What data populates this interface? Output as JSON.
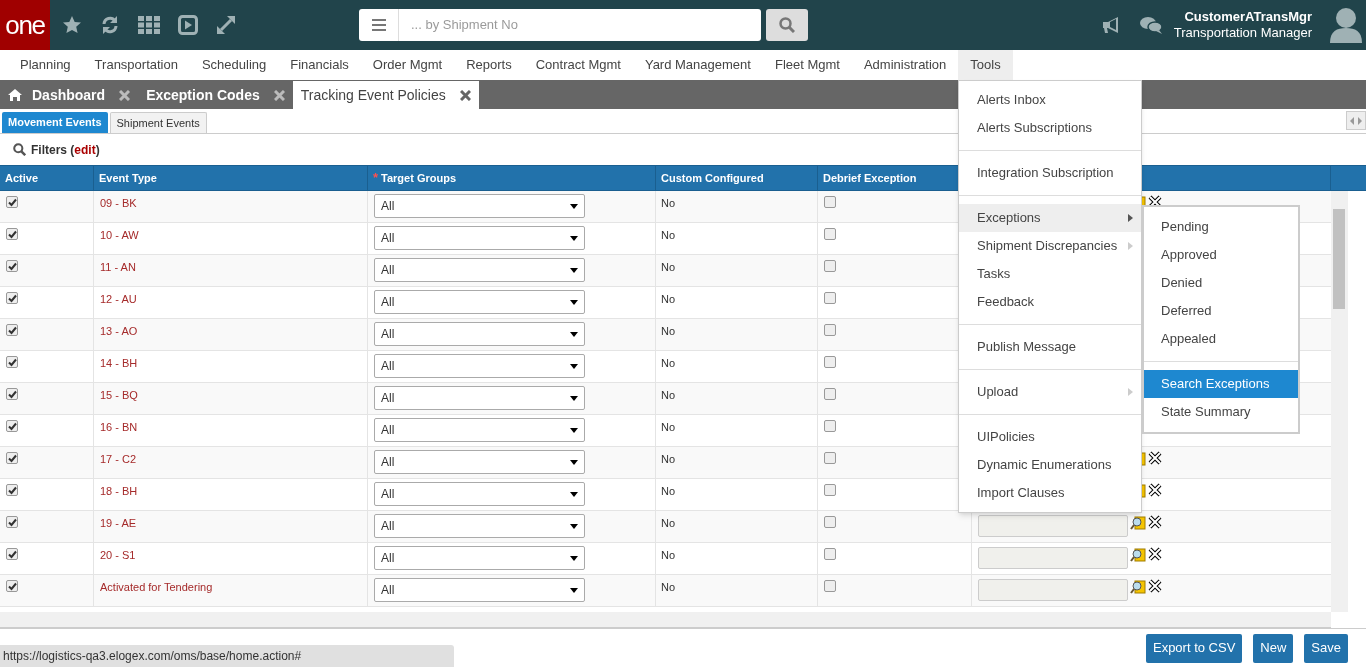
{
  "logo": "one",
  "search": {
    "placeholder": "... by Shipment No"
  },
  "user": {
    "name": "CustomerATransMgr",
    "role": "Transportation Manager"
  },
  "nav": [
    {
      "label": "Planning",
      "selected": false
    },
    {
      "label": "Transportation",
      "selected": false
    },
    {
      "label": "Scheduling",
      "selected": false
    },
    {
      "label": "Financials",
      "selected": false
    },
    {
      "label": "Order Mgmt",
      "selected": false
    },
    {
      "label": "Reports",
      "selected": false
    },
    {
      "label": "Contract Mgmt",
      "selected": false
    },
    {
      "label": "Yard Management",
      "selected": false
    },
    {
      "label": "Fleet Mgmt",
      "selected": false
    },
    {
      "label": "Administration",
      "selected": false
    },
    {
      "label": "Tools",
      "selected": true
    }
  ],
  "tabs": [
    {
      "label": "Dashboard",
      "kind": "home",
      "selected": false
    },
    {
      "label": "Exception Codes",
      "kind": "plain",
      "selected": false
    },
    {
      "label": "Tracking Event Policies",
      "kind": "plain",
      "selected": true
    }
  ],
  "subtabs": [
    {
      "label": "Movement Events",
      "selected": true
    },
    {
      "label": "Shipment Events",
      "selected": false
    }
  ],
  "filters": {
    "label": "Filters (",
    "link": "edit",
    "suffix": ")"
  },
  "table": {
    "columns": [
      {
        "label": "Active"
      },
      {
        "label": "Event Type"
      },
      {
        "label": "Target Groups",
        "required_mark": "*"
      },
      {
        "label": "Custom Configured"
      },
      {
        "label": "Debrief Exception"
      }
    ],
    "rows": [
      {
        "active": true,
        "event_type": "09 - BK",
        "target_groups": "All",
        "custom_configured": "No",
        "debrief": false
      },
      {
        "active": true,
        "event_type": "10 - AW",
        "target_groups": "All",
        "custom_configured": "No",
        "debrief": false
      },
      {
        "active": true,
        "event_type": "11 - AN",
        "target_groups": "All",
        "custom_configured": "No",
        "debrief": false
      },
      {
        "active": true,
        "event_type": "12 - AU",
        "target_groups": "All",
        "custom_configured": "No",
        "debrief": false
      },
      {
        "active": true,
        "event_type": "13 - AO",
        "target_groups": "All",
        "custom_configured": "No",
        "debrief": false
      },
      {
        "active": true,
        "event_type": "14 - BH",
        "target_groups": "All",
        "custom_configured": "No",
        "debrief": false
      },
      {
        "active": true,
        "event_type": "15 - BQ",
        "target_groups": "All",
        "custom_configured": "No",
        "debrief": false
      },
      {
        "active": true,
        "event_type": "16 - BN",
        "target_groups": "All",
        "custom_configured": "No",
        "debrief": false
      },
      {
        "active": true,
        "event_type": "17 - C2",
        "target_groups": "All",
        "custom_configured": "No",
        "debrief": false
      },
      {
        "active": true,
        "event_type": "18 - BH",
        "target_groups": "All",
        "custom_configured": "No",
        "debrief": false
      },
      {
        "active": true,
        "event_type": "19 - AE",
        "target_groups": "All",
        "custom_configured": "No",
        "debrief": false
      },
      {
        "active": true,
        "event_type": "20 - S1",
        "target_groups": "All",
        "custom_configured": "No",
        "debrief": false
      },
      {
        "active": true,
        "event_type": "Activated for Tendering",
        "target_groups": "All",
        "custom_configured": "No",
        "debrief": false
      }
    ]
  },
  "tools_menu": [
    [
      {
        "label": "Alerts Inbox",
        "submenu": false,
        "expanded": false
      },
      {
        "label": "Alerts Subscriptions",
        "submenu": false,
        "expanded": false
      }
    ],
    [
      {
        "label": "Integration Subscription",
        "submenu": false,
        "expanded": false
      }
    ],
    [
      {
        "label": "Exceptions",
        "submenu": true,
        "expanded": true
      },
      {
        "label": "Shipment Discrepancies",
        "submenu": true,
        "expanded": false
      },
      {
        "label": "Tasks",
        "submenu": false,
        "expanded": false
      },
      {
        "label": "Feedback",
        "submenu": false,
        "expanded": false
      }
    ],
    [
      {
        "label": "Publish Message",
        "submenu": false,
        "expanded": false
      }
    ],
    [
      {
        "label": "Upload",
        "submenu": true,
        "expanded": false
      }
    ],
    [
      {
        "label": "UIPolicies",
        "submenu": false,
        "expanded": false
      },
      {
        "label": "Dynamic Enumerations",
        "submenu": false,
        "expanded": false
      },
      {
        "label": "Import Clauses",
        "submenu": false,
        "expanded": false
      }
    ]
  ],
  "exceptions_submenu": [
    [
      {
        "label": "Pending",
        "selected": false
      },
      {
        "label": "Approved",
        "selected": false
      },
      {
        "label": "Denied",
        "selected": false
      },
      {
        "label": "Deferred",
        "selected": false
      },
      {
        "label": "Appealed",
        "selected": false
      }
    ],
    [
      {
        "label": "Search Exceptions",
        "selected": true
      },
      {
        "label": "State Summary",
        "selected": false
      }
    ]
  ],
  "buttons": [
    "Export to CSV",
    "New",
    "Save"
  ],
  "status_url": "https://logistics-qa3.elogex.com/oms/base/home.action#"
}
